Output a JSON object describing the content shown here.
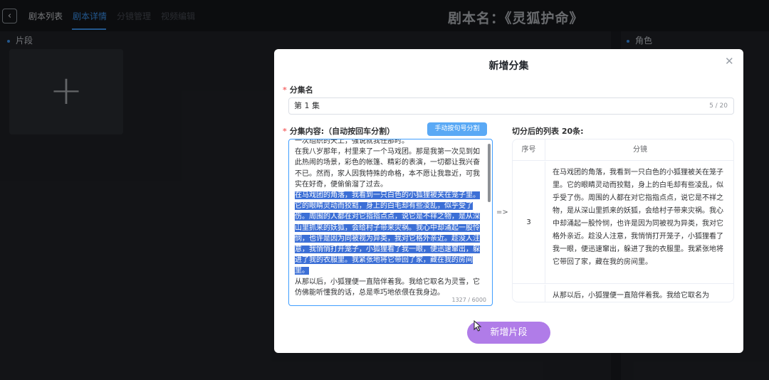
{
  "nav": {
    "back_icon": "chevron-left-icon",
    "tabs": [
      {
        "label": "剧本列表"
      },
      {
        "label": "剧本详情"
      },
      {
        "label": "分镜管理"
      },
      {
        "label": "视频编辑"
      }
    ],
    "active_tab": "剧本详情",
    "title": "剧本名：《灵狐护命》"
  },
  "left_panel": {
    "section_label": "片段",
    "add_icon": "plus-icon"
  },
  "right_panel": {
    "section_label": "角色"
  },
  "modal": {
    "title": "新增分集",
    "close_icon": "close-icon",
    "required_mark": "*",
    "name_label": "分集名",
    "name_value": "第 1 集",
    "name_count": "5 / 20",
    "content_label": "分集内容:（自动按回车分割）",
    "split_button": "手动按句号分割",
    "content": {
      "line0": "一次组织的天上，强说就我任那时。",
      "para1": "在我八岁那年，村里来了一个马戏团。那是我第一次见到如此热闹的场景，彩色的帐篷、精彩的表演，一切都让我兴奋不已。然而，家人因我特殊的命格，本不愿让我靠近，可我实在好奇，便偷偷溜了过去。",
      "para2": "在马戏团的角落，我看到一只白色的小狐狸被关在笼子里。它的眼睛灵动而狡黠，身上的白毛却有些凌乱，似乎受了伤。周围的人都在对它指指点点，说它是不祥之物，是从深山里抓来的妖狐，会给村子带来灾祸。我心中却涌起一股怜悯，也许是因为同被视为异类，我对它格外亲近。趁没人注意，我悄悄打开笼子，小狐狸看了我一眼，便迅速窜出，躲进了我的衣服里。我紧张地将它带回了家，藏在我的房间里。",
      "para3": "从那以后，小狐狸便一直陪伴着我。我给它取名为灵雪，它仿佛能听懂我的话，总是乖巧地依偎在我身边。"
    },
    "content_count": "1327 / 6000",
    "arrow": "=>",
    "list_title": "切分后的列表 20条:",
    "list_headers": {
      "index": "序号",
      "segment": "分镜"
    },
    "rows": [
      {
        "index": "3",
        "text": "在马戏团的角落，我看到一只白色的小狐狸被关在笼子里。它的眼睛灵动而狡黠，身上的白毛却有些凌乱，似乎受了伤。周围的人都在对它指指点点，说它是不祥之物，是从深山里抓来的妖狐，会给村子带来灾祸。我心中却涌起一股怜悯，也许是因为同被视为异类，我对它格外亲近。趁没人注意，我悄悄打开笼子，小狐狸看了我一眼，便迅速窜出，躲进了我的衣服里。我紧张地将它带回了家，藏在我的房间里。"
      },
      {
        "index": "",
        "text": "从那以后，小狐狸便一直陪伴着我。我给它取名为"
      }
    ],
    "submit_button": "新增片段"
  },
  "colors": {
    "accent": "#409eff",
    "submit": "#b07ce8",
    "split_button": "#5aa9f5",
    "highlight": "#3c6fd6",
    "required": "#f56c6c"
  }
}
